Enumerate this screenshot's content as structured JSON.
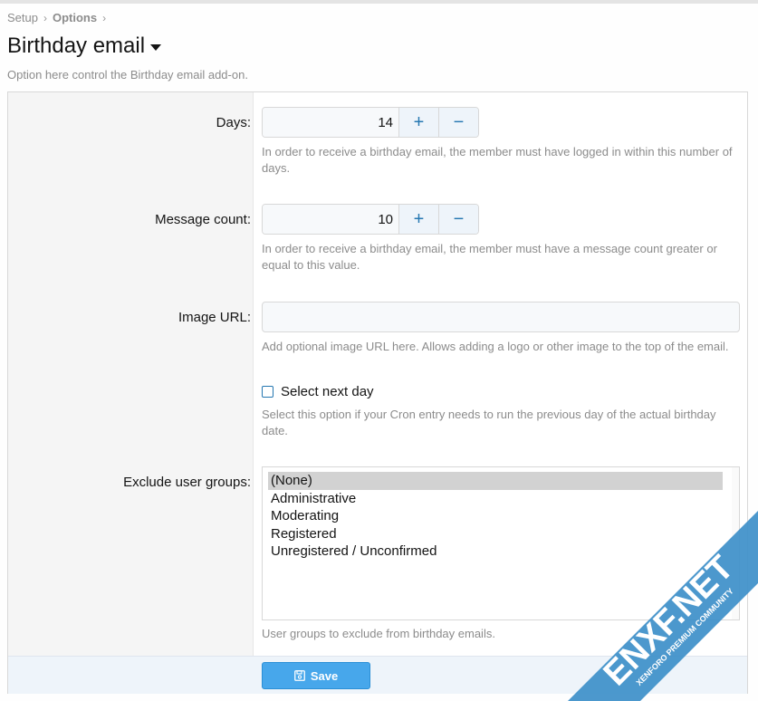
{
  "breadcrumb": {
    "items": [
      "Setup",
      "Options"
    ]
  },
  "page": {
    "title": "Birthday email",
    "description": "Option here control the Birthday email add-on."
  },
  "form": {
    "days": {
      "label": "Days:",
      "value": "14",
      "hint": "In order to receive a birthday email, the member must have logged in within this number of days."
    },
    "message_count": {
      "label": "Message count:",
      "value": "10",
      "hint": "In order to receive a birthday email, the member must have a message count greater or equal to this value."
    },
    "image_url": {
      "label": "Image URL:",
      "value": "",
      "hint": "Add optional image URL here. Allows adding a logo or other image to the top of the email."
    },
    "select_next_day": {
      "label": "Select next day",
      "checked": false,
      "hint": "Select this option if your Cron entry needs to run the previous day of the actual birthday date."
    },
    "exclude_groups": {
      "label": "Exclude user groups:",
      "options": [
        "(None)",
        "Administrative",
        "Moderating",
        "Registered",
        "Unregistered / Unconfirmed"
      ],
      "selected": "(None)",
      "hint": "User groups to exclude from birthday emails."
    },
    "save_label": "Save"
  },
  "stepper": {
    "plus": "+",
    "minus": "−"
  },
  "icons": {
    "step_up": "plus-icon",
    "step_down": "minus-icon",
    "save": "floppy-disk-icon",
    "breadcrumb_sep": "chevron-right-icon",
    "title_menu": "caret-down-icon"
  },
  "watermark": {
    "brand": "ENXF.NET",
    "tagline": "XENFORO PREMIUM COMMUNITY"
  },
  "colors": {
    "accent": "#2577b1",
    "button": "#47a7eb",
    "footer": "#eef4fa",
    "label_bg": "#f5f5f5",
    "muted": "#8c8c8c"
  }
}
